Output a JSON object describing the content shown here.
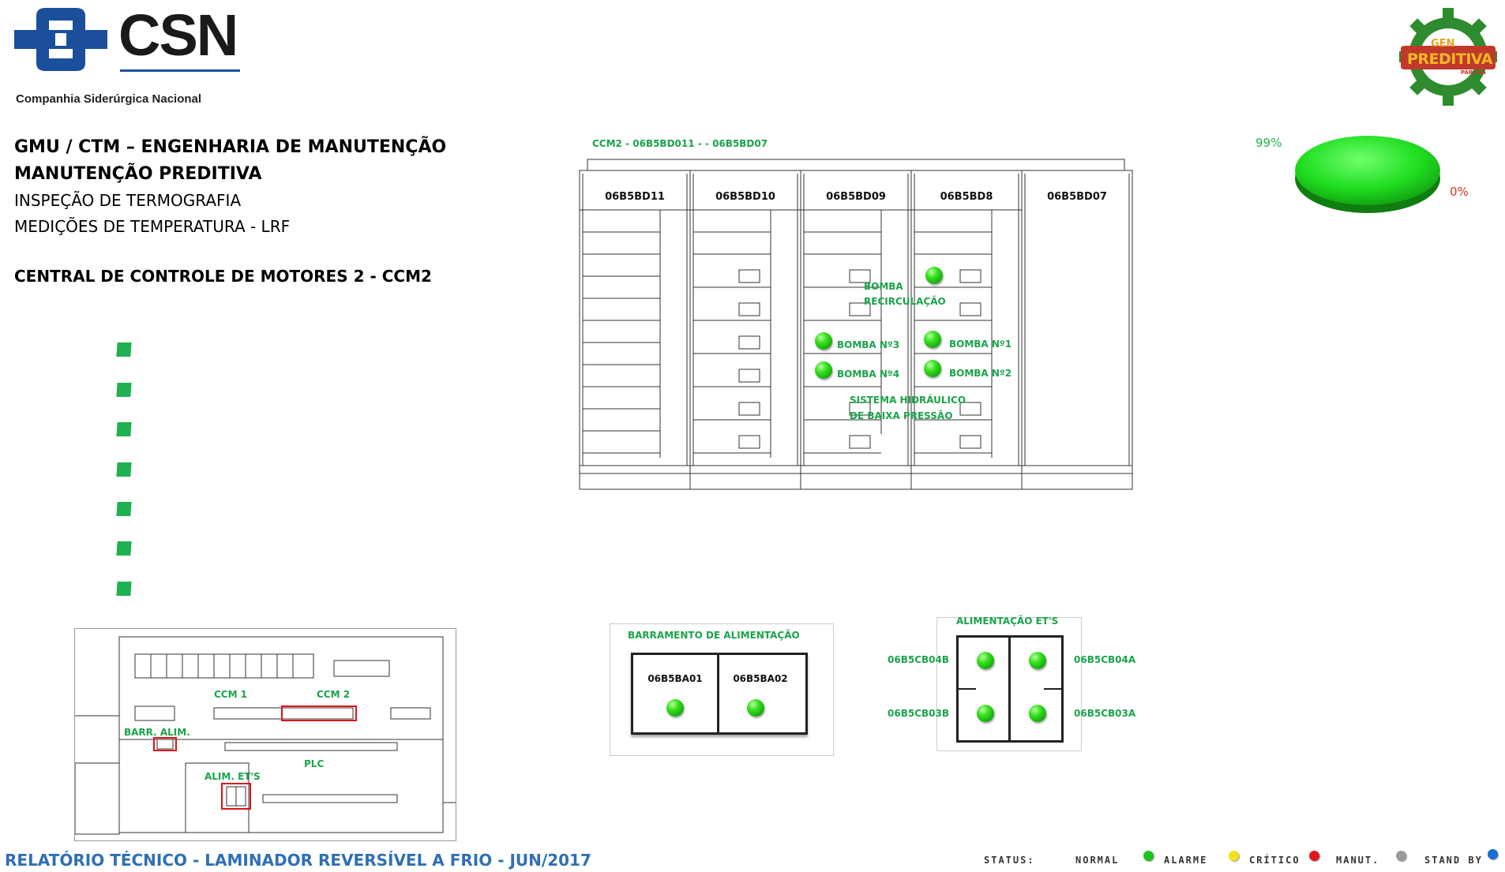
{
  "header": {
    "company_logo_text": "CSN",
    "company_name": "Companhia Siderúrgica Nacional",
    "partner_logo_text_1": "GEN",
    "partner_logo_text_2": "PREDITIVA",
    "partner_logo_text_3": "PARANÁ"
  },
  "titles": {
    "line1": "GMU / CTM – ENGENHARIA DE MANUTENÇÃO",
    "line2": "MANUTENÇÃO PREDITIVA",
    "line3": "INSPEÇÃO DE TERMOGRAFIA",
    "line4": "MEDIÇÕES DE TEMPERATURA - LRF",
    "section": "CENTRAL DE CONTROLE DE MOTORES 2 - CCM2"
  },
  "pie": {
    "label_normal": "99%",
    "label_other": "0%",
    "color_normal": "#1fdc1f",
    "color_other": "#e03020"
  },
  "ccm2": {
    "title": "CCM2 - 06B5BD011 - - 06B5BD07",
    "columns": [
      "06B5BD11",
      "06B5BD10",
      "06B5BD09",
      "06B5BD8",
      "06B5BD07"
    ],
    "labels": {
      "bomba_recirc_1": "BOMBA",
      "bomba_recirc_2": "RECIRCULAÇÃO",
      "bomba3": "BOMBA  Nº3",
      "bomba4": "BOMBA  Nº4",
      "bomba1": "BOMBA  Nº1",
      "bomba2": "BOMBA  Nº2",
      "sistema1": "SISTEMA  HIDRÁULICO",
      "sistema2": "DE BAIXA PRESSÃO"
    }
  },
  "barramento": {
    "title": "BARRAMENTO  DE ALIMENTAÇÃO",
    "left": "06B5BA01",
    "right": "06B5BA02"
  },
  "alimentacao": {
    "title": "ALIMENTAÇÃO  ET'S",
    "tl": "06B5CB04B",
    "tr": "06B5CB04A",
    "bl": "06B5CB03B",
    "br": "06B5CB03A"
  },
  "floorplan": {
    "ccm1": "CCM 1",
    "ccm2": "CCM 2",
    "barr": "BARR.  ALIM.",
    "plc": "PLC",
    "alim": "ALIM.  ET'S"
  },
  "footer": {
    "report_title": "RELATÓRIO TÉCNICO - LAMINADOR REVERSÍVEL A FRIO - JUN/2017",
    "status_label": "STATUS:",
    "legend": [
      {
        "label": "NORMAL",
        "color": "#1ec41e"
      },
      {
        "label": "ALARME",
        "color": "#f2e21a"
      },
      {
        "label": "CRÍTICO",
        "color": "#e01818"
      },
      {
        "label": "MANUT.",
        "color": "#9a9a9a"
      },
      {
        "label": "STAND BY",
        "color": "#1a6fd6"
      }
    ]
  }
}
